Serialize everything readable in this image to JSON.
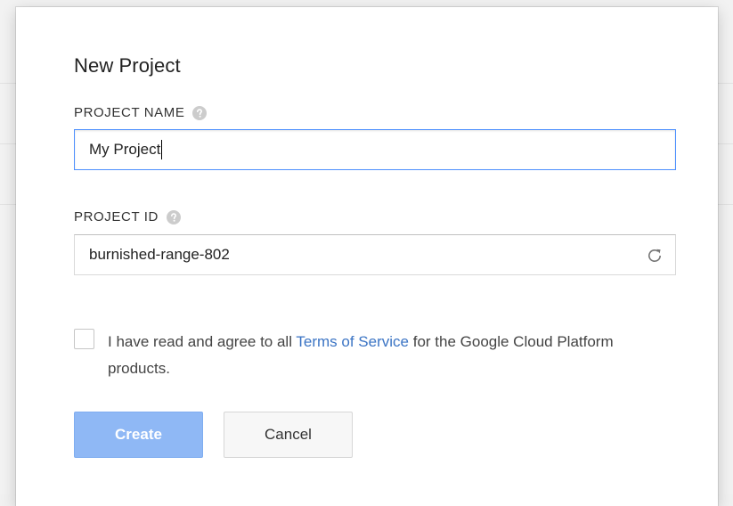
{
  "dialog": {
    "title": "New Project",
    "project_name": {
      "label": "PROJECT NAME",
      "value": "My Project"
    },
    "project_id": {
      "label": "PROJECT ID",
      "value": "burnished-range-802"
    },
    "terms": {
      "checked": false,
      "text_before": "I have read and agree to all ",
      "link_text": "Terms of Service",
      "text_after": " for the Google Cloud Platform products."
    },
    "buttons": {
      "create_label": "Create",
      "cancel_label": "Cancel"
    }
  },
  "colors": {
    "focus_border": "#4d90fe",
    "link": "#3b74c4",
    "create_button_disabled": "#8fb8f5",
    "help_icon": "#cccccc"
  },
  "icons": {
    "help": "help-circle-icon",
    "refresh": "refresh-icon"
  }
}
